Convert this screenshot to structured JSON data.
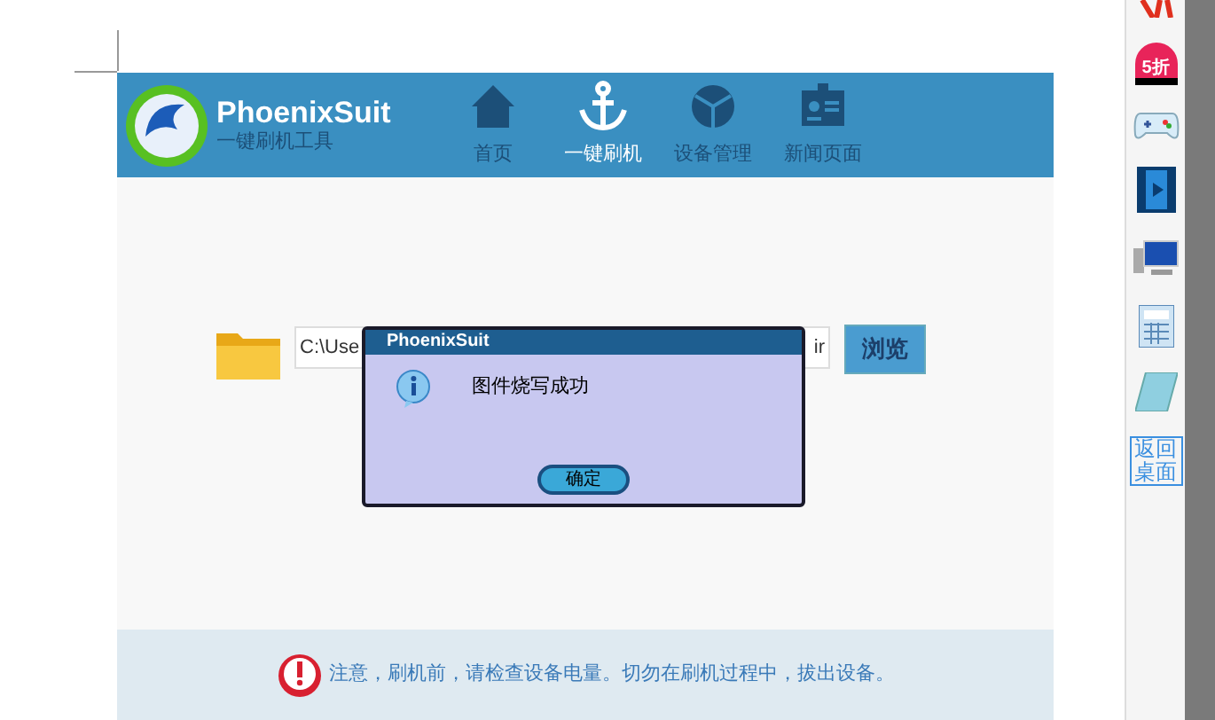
{
  "app": {
    "logo_title": "PhoenixSuit",
    "logo_subtitle": "一键刷机工具"
  },
  "nav": [
    {
      "label": "首页",
      "kind": "home",
      "selected": false
    },
    {
      "label": "一键刷机",
      "kind": "anchor",
      "selected": true
    },
    {
      "label": "设备管理",
      "kind": "cube",
      "selected": false
    },
    {
      "label": "新闻页面",
      "kind": "badge",
      "selected": false
    }
  ],
  "firmware_path": {
    "value_start": "C:\\Use",
    "value_end": "ir"
  },
  "browse_button": "浏览",
  "dialog": {
    "title": "PhoenixSuit",
    "message": "图件烧写成功",
    "ok_button": "确定"
  },
  "notice": "注意，刷机前，请检查设备电量。切勿在刷机过程中，拔出设备。",
  "sidebar": [
    {
      "kind": "red"
    },
    {
      "kind": "sale",
      "label": "5折"
    },
    {
      "kind": "gamepad"
    },
    {
      "kind": "film"
    },
    {
      "kind": "computer"
    },
    {
      "kind": "calculator"
    },
    {
      "kind": "notepad"
    },
    {
      "kind": "desktop",
      "label": "返回桌面"
    }
  ]
}
